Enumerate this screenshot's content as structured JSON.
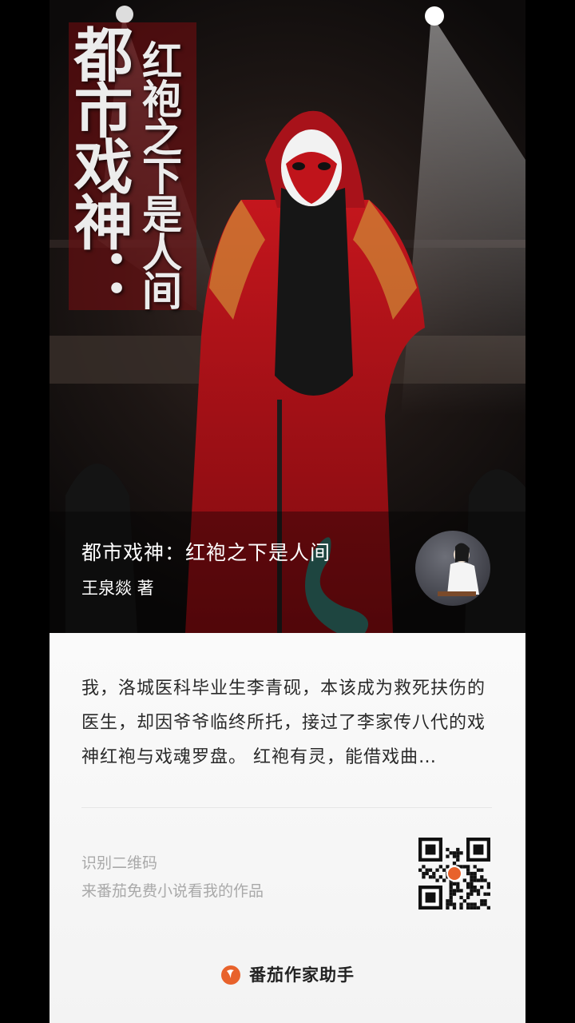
{
  "cover": {
    "vertical_title_main": "都市戏神：",
    "vertical_title_sub": "红袍之下是人间",
    "title": "都市戏神：红袍之下是人间",
    "author_line": "王泉燚 著",
    "avatar_icon": "author-avatar",
    "colors": {
      "robe": "#b3141a",
      "title_backdrop": "#7a0d10"
    }
  },
  "synopsis": "我，洛城医科毕业生李青砚，本该成为救死扶伤的医生，却因爷爷临终所托，接过了李家传八代的戏神红袍与戏魂罗盘。 红袍有灵，能借戏曲…",
  "qr_section": {
    "line1": "识别二维码",
    "line2": "来番茄免费小说看我的作品",
    "qr_icon": "qr-code",
    "qr_accent": "#e8622b"
  },
  "footer": {
    "brand": "番茄作家助手",
    "logo_icon": "tomato-logo",
    "logo_color": "#e8622b"
  }
}
